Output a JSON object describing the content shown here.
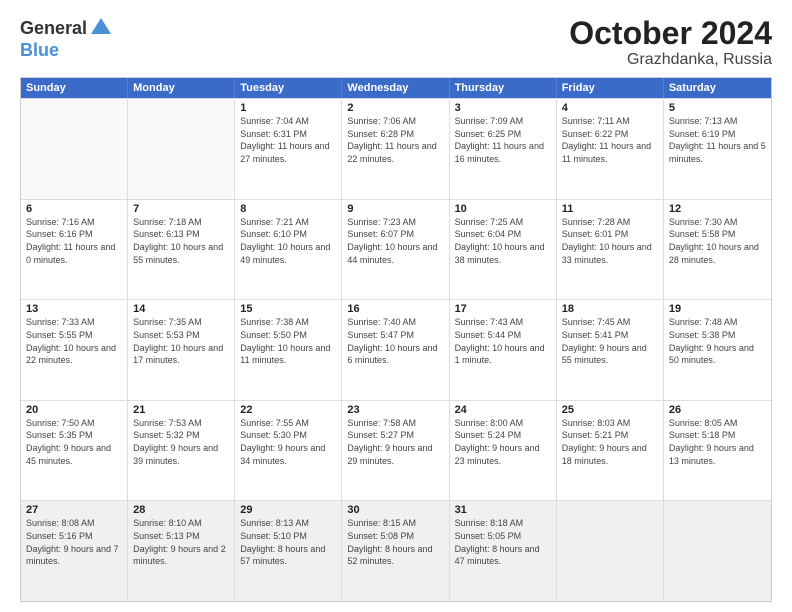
{
  "header": {
    "logo_general": "General",
    "logo_blue": "Blue",
    "month": "October 2024",
    "location": "Grazhdanka, Russia"
  },
  "days": [
    "Sunday",
    "Monday",
    "Tuesday",
    "Wednesday",
    "Thursday",
    "Friday",
    "Saturday"
  ],
  "weeks": [
    [
      {
        "date": "",
        "sunrise": "",
        "sunset": "",
        "daylight": "",
        "empty": true
      },
      {
        "date": "",
        "sunrise": "",
        "sunset": "",
        "daylight": "",
        "empty": true
      },
      {
        "date": "1",
        "sunrise": "Sunrise: 7:04 AM",
        "sunset": "Sunset: 6:31 PM",
        "daylight": "Daylight: 11 hours and 27 minutes.",
        "empty": false
      },
      {
        "date": "2",
        "sunrise": "Sunrise: 7:06 AM",
        "sunset": "Sunset: 6:28 PM",
        "daylight": "Daylight: 11 hours and 22 minutes.",
        "empty": false
      },
      {
        "date": "3",
        "sunrise": "Sunrise: 7:09 AM",
        "sunset": "Sunset: 6:25 PM",
        "daylight": "Daylight: 11 hours and 16 minutes.",
        "empty": false
      },
      {
        "date": "4",
        "sunrise": "Sunrise: 7:11 AM",
        "sunset": "Sunset: 6:22 PM",
        "daylight": "Daylight: 11 hours and 11 minutes.",
        "empty": false
      },
      {
        "date": "5",
        "sunrise": "Sunrise: 7:13 AM",
        "sunset": "Sunset: 6:19 PM",
        "daylight": "Daylight: 11 hours and 5 minutes.",
        "empty": false
      }
    ],
    [
      {
        "date": "6",
        "sunrise": "Sunrise: 7:16 AM",
        "sunset": "Sunset: 6:16 PM",
        "daylight": "Daylight: 11 hours and 0 minutes.",
        "empty": false
      },
      {
        "date": "7",
        "sunrise": "Sunrise: 7:18 AM",
        "sunset": "Sunset: 6:13 PM",
        "daylight": "Daylight: 10 hours and 55 minutes.",
        "empty": false
      },
      {
        "date": "8",
        "sunrise": "Sunrise: 7:21 AM",
        "sunset": "Sunset: 6:10 PM",
        "daylight": "Daylight: 10 hours and 49 minutes.",
        "empty": false
      },
      {
        "date": "9",
        "sunrise": "Sunrise: 7:23 AM",
        "sunset": "Sunset: 6:07 PM",
        "daylight": "Daylight: 10 hours and 44 minutes.",
        "empty": false
      },
      {
        "date": "10",
        "sunrise": "Sunrise: 7:25 AM",
        "sunset": "Sunset: 6:04 PM",
        "daylight": "Daylight: 10 hours and 38 minutes.",
        "empty": false
      },
      {
        "date": "11",
        "sunrise": "Sunrise: 7:28 AM",
        "sunset": "Sunset: 6:01 PM",
        "daylight": "Daylight: 10 hours and 33 minutes.",
        "empty": false
      },
      {
        "date": "12",
        "sunrise": "Sunrise: 7:30 AM",
        "sunset": "Sunset: 5:58 PM",
        "daylight": "Daylight: 10 hours and 28 minutes.",
        "empty": false
      }
    ],
    [
      {
        "date": "13",
        "sunrise": "Sunrise: 7:33 AM",
        "sunset": "Sunset: 5:55 PM",
        "daylight": "Daylight: 10 hours and 22 minutes.",
        "empty": false
      },
      {
        "date": "14",
        "sunrise": "Sunrise: 7:35 AM",
        "sunset": "Sunset: 5:53 PM",
        "daylight": "Daylight: 10 hours and 17 minutes.",
        "empty": false
      },
      {
        "date": "15",
        "sunrise": "Sunrise: 7:38 AM",
        "sunset": "Sunset: 5:50 PM",
        "daylight": "Daylight: 10 hours and 11 minutes.",
        "empty": false
      },
      {
        "date": "16",
        "sunrise": "Sunrise: 7:40 AM",
        "sunset": "Sunset: 5:47 PM",
        "daylight": "Daylight: 10 hours and 6 minutes.",
        "empty": false
      },
      {
        "date": "17",
        "sunrise": "Sunrise: 7:43 AM",
        "sunset": "Sunset: 5:44 PM",
        "daylight": "Daylight: 10 hours and 1 minute.",
        "empty": false
      },
      {
        "date": "18",
        "sunrise": "Sunrise: 7:45 AM",
        "sunset": "Sunset: 5:41 PM",
        "daylight": "Daylight: 9 hours and 55 minutes.",
        "empty": false
      },
      {
        "date": "19",
        "sunrise": "Sunrise: 7:48 AM",
        "sunset": "Sunset: 5:38 PM",
        "daylight": "Daylight: 9 hours and 50 minutes.",
        "empty": false
      }
    ],
    [
      {
        "date": "20",
        "sunrise": "Sunrise: 7:50 AM",
        "sunset": "Sunset: 5:35 PM",
        "daylight": "Daylight: 9 hours and 45 minutes.",
        "empty": false
      },
      {
        "date": "21",
        "sunrise": "Sunrise: 7:53 AM",
        "sunset": "Sunset: 5:32 PM",
        "daylight": "Daylight: 9 hours and 39 minutes.",
        "empty": false
      },
      {
        "date": "22",
        "sunrise": "Sunrise: 7:55 AM",
        "sunset": "Sunset: 5:30 PM",
        "daylight": "Daylight: 9 hours and 34 minutes.",
        "empty": false
      },
      {
        "date": "23",
        "sunrise": "Sunrise: 7:58 AM",
        "sunset": "Sunset: 5:27 PM",
        "daylight": "Daylight: 9 hours and 29 minutes.",
        "empty": false
      },
      {
        "date": "24",
        "sunrise": "Sunrise: 8:00 AM",
        "sunset": "Sunset: 5:24 PM",
        "daylight": "Daylight: 9 hours and 23 minutes.",
        "empty": false
      },
      {
        "date": "25",
        "sunrise": "Sunrise: 8:03 AM",
        "sunset": "Sunset: 5:21 PM",
        "daylight": "Daylight: 9 hours and 18 minutes.",
        "empty": false
      },
      {
        "date": "26",
        "sunrise": "Sunrise: 8:05 AM",
        "sunset": "Sunset: 5:18 PM",
        "daylight": "Daylight: 9 hours and 13 minutes.",
        "empty": false
      }
    ],
    [
      {
        "date": "27",
        "sunrise": "Sunrise: 8:08 AM",
        "sunset": "Sunset: 5:16 PM",
        "daylight": "Daylight: 9 hours and 7 minutes.",
        "empty": false
      },
      {
        "date": "28",
        "sunrise": "Sunrise: 8:10 AM",
        "sunset": "Sunset: 5:13 PM",
        "daylight": "Daylight: 9 hours and 2 minutes.",
        "empty": false
      },
      {
        "date": "29",
        "sunrise": "Sunrise: 8:13 AM",
        "sunset": "Sunset: 5:10 PM",
        "daylight": "Daylight: 8 hours and 57 minutes.",
        "empty": false
      },
      {
        "date": "30",
        "sunrise": "Sunrise: 8:15 AM",
        "sunset": "Sunset: 5:08 PM",
        "daylight": "Daylight: 8 hours and 52 minutes.",
        "empty": false
      },
      {
        "date": "31",
        "sunrise": "Sunrise: 8:18 AM",
        "sunset": "Sunset: 5:05 PM",
        "daylight": "Daylight: 8 hours and 47 minutes.",
        "empty": false
      },
      {
        "date": "",
        "sunrise": "",
        "sunset": "",
        "daylight": "",
        "empty": true
      },
      {
        "date": "",
        "sunrise": "",
        "sunset": "",
        "daylight": "",
        "empty": true
      }
    ]
  ]
}
